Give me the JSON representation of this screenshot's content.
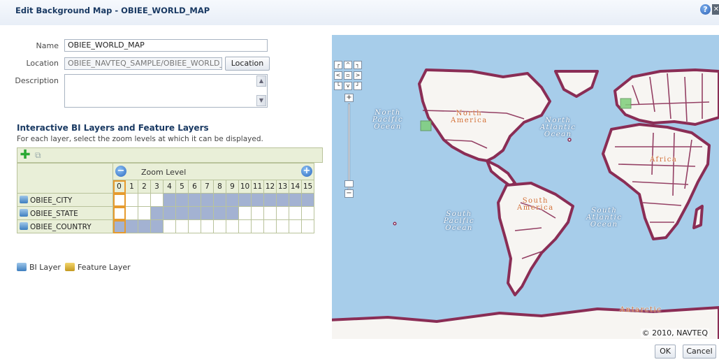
{
  "dialog": {
    "title": "Edit Background Map - OBIEE_WORLD_MAP",
    "help_icon": "help-icon",
    "close_icon": "close-icon"
  },
  "form": {
    "name_label": "Name",
    "name_value": "OBIEE_WORLD_MAP",
    "location_label": "Location",
    "location_value": "OBIEE_NAVTEQ_SAMPLE/OBIEE_WORLD_",
    "location_button": "Location",
    "description_label": "Description",
    "description_value": ""
  },
  "layers_section": {
    "title": "Interactive BI Layers and Feature Layers",
    "subtitle": "For each layer, select the zoom levels at which it can be displayed.",
    "zoom_level_label": "Zoom Level",
    "zoom_levels": [
      "0",
      "1",
      "2",
      "3",
      "4",
      "5",
      "6",
      "7",
      "8",
      "9",
      "10",
      "11",
      "12",
      "13",
      "14",
      "15"
    ],
    "selected_zoom": "0",
    "layers": [
      {
        "name": "OBIEE_CITY",
        "enabled": [
          false,
          false,
          false,
          false,
          true,
          true,
          true,
          true,
          true,
          true,
          true,
          true,
          true,
          true,
          true,
          true
        ]
      },
      {
        "name": "OBIEE_STATE",
        "enabled": [
          false,
          false,
          false,
          true,
          true,
          true,
          true,
          true,
          true,
          true,
          false,
          false,
          false,
          false,
          false,
          false
        ]
      },
      {
        "name": "OBIEE_COUNTRY",
        "enabled": [
          true,
          true,
          true,
          true,
          false,
          false,
          false,
          false,
          false,
          false,
          false,
          false,
          false,
          false,
          false,
          false
        ]
      }
    ]
  },
  "legend": {
    "bi_layer": "BI Layer",
    "feature_layer": "Feature Layer"
  },
  "map": {
    "labels": {
      "north_pacific": [
        "North",
        "Pacific",
        "Ocean"
      ],
      "north_america": [
        "North",
        "America"
      ],
      "north_atlantic": [
        "North",
        "Atlantic",
        "Ocean"
      ],
      "south_america": [
        "South",
        "America"
      ],
      "south_pacific": [
        "South",
        "Pacific",
        "Ocean"
      ],
      "south_atlantic": [
        "South",
        "Atlantic",
        "Ocean"
      ],
      "africa": "Africa",
      "antarctic": "Antarctic"
    },
    "copyright": "© 2010, NAVTEQ",
    "colors": {
      "ocean": "#a7cdea",
      "land": "#f7f5f2",
      "border": "#8a2d55",
      "highlight": "#7fcf7a"
    }
  },
  "footer": {
    "ok": "OK",
    "cancel": "Cancel"
  }
}
